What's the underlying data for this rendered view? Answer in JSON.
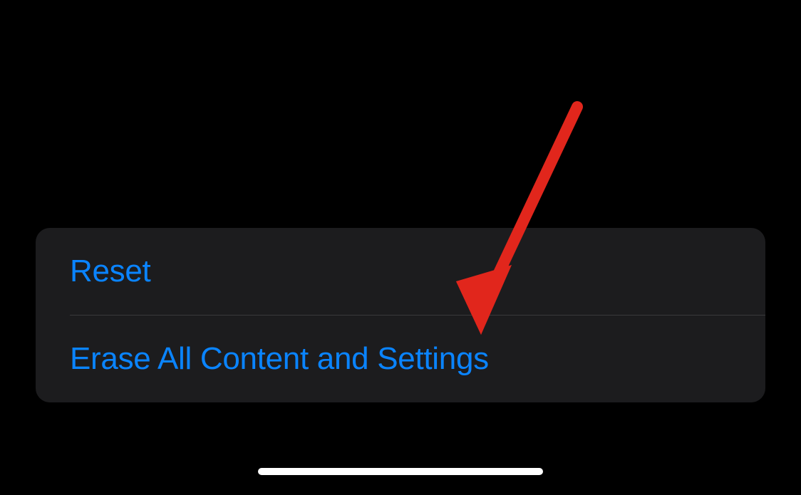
{
  "settings": {
    "rows": [
      {
        "label": "Reset"
      },
      {
        "label": "Erase All Content and Settings"
      }
    ]
  },
  "annotation": {
    "arrow_color": "#e1261c"
  }
}
